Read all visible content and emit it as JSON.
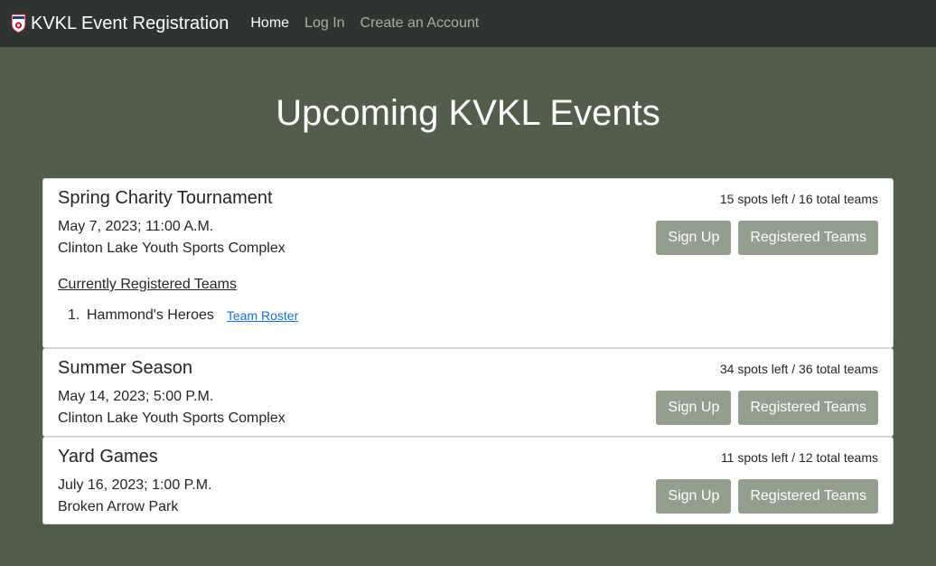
{
  "nav": {
    "brand": "KVKL Event Registration",
    "links": [
      {
        "label": "Home"
      },
      {
        "label": "Log In"
      },
      {
        "label": "Create an Account"
      }
    ]
  },
  "page": {
    "title": "Upcoming KVKL Events"
  },
  "events": [
    {
      "name": "Spring Charity Tournament",
      "spots": "15 spots left / 16 total teams",
      "date": "May 7, 2023; 11:00 A.M.",
      "location": "Clinton Lake Youth Sports Complex",
      "signup_label": "Sign Up",
      "registered_label": "Registered Teams",
      "registered_heading": "Currently Registered Teams",
      "teams": [
        {
          "num": "1.",
          "name": "Hammond's Heroes",
          "link": "Team Roster"
        }
      ]
    },
    {
      "name": "Summer Season",
      "spots": "34 spots left / 36 total teams",
      "date": "May 14, 2023; 5:00 P.M.",
      "location": "Clinton Lake Youth Sports Complex",
      "signup_label": "Sign Up",
      "registered_label": "Registered Teams"
    },
    {
      "name": "Yard Games",
      "spots": "11 spots left / 12 total teams",
      "date": "July 16, 2023; 1:00 P.M.",
      "location": "Broken Arrow Park",
      "signup_label": "Sign Up",
      "registered_label": "Registered Teams"
    }
  ],
  "colors": {
    "page_bg": "#525e4b",
    "navbar_bg": "#2f3430",
    "button_bg": "#939e8f",
    "link": "#1a6fd4"
  },
  "icons": {
    "brand_logo": "kvkl-logo-icon"
  }
}
